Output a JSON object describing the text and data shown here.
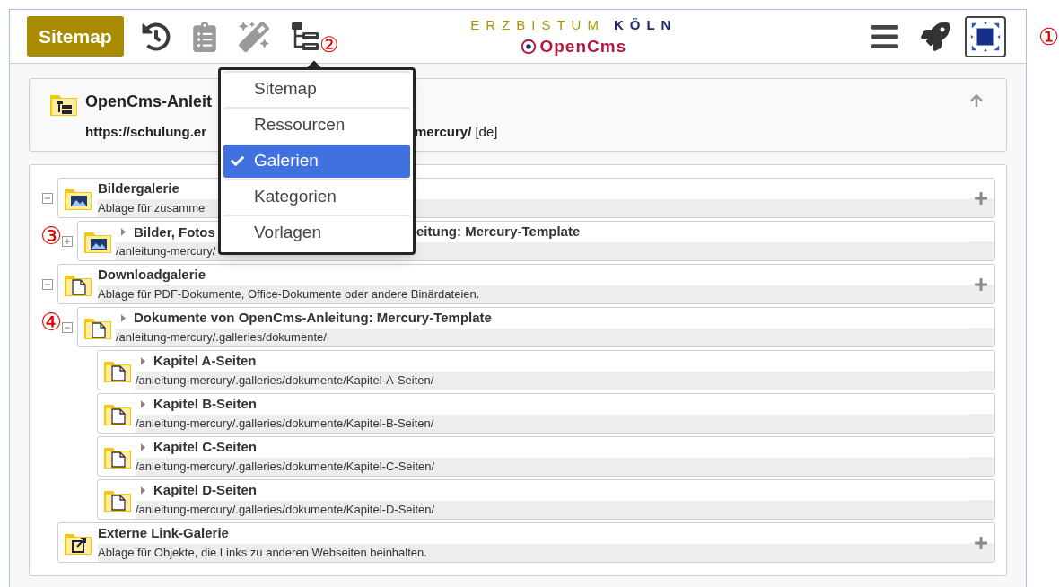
{
  "toolbar": {
    "title_button": "Sitemap",
    "tools": [
      {
        "kind": "history",
        "disabled": false
      },
      {
        "kind": "clipboard",
        "disabled": true
      },
      {
        "kind": "wand",
        "disabled": true
      },
      {
        "kind": "sitemap",
        "disabled": false,
        "marker": "②"
      }
    ],
    "logo": {
      "line_1": "ERZBISTUM",
      "line_1_accent": "KÖLN",
      "brand": "OpenCms"
    },
    "right_tools": [
      {
        "kind": "menu",
        "selected": false
      },
      {
        "kind": "rocket",
        "selected": false
      },
      {
        "kind": "select-area",
        "selected": true,
        "marker": "①"
      }
    ]
  },
  "view_menu": {
    "items": [
      {
        "label": "Sitemap",
        "selected": false
      },
      {
        "label": "Ressourcen",
        "selected": false
      },
      {
        "label": "Galerien",
        "selected": true
      },
      {
        "label": "Kategorien",
        "selected": false
      },
      {
        "label": "Vorlagen",
        "selected": false
      }
    ]
  },
  "header_card": {
    "title": "OpenCms-Anleit",
    "url_parts": [
      "https://schulung.er",
      "mercury/"
    ],
    "locale": "[de]"
  },
  "tree": [
    {
      "kind": "image-gallery",
      "title_parts": [
        "Bildergalerie"
      ],
      "subtitle_parts": [
        "Ablage für zusamme"
      ],
      "expanded": true,
      "addable": true,
      "children": [
        {
          "kind": "image-gallery",
          "title_parts": [
            "Bilder, Fotos",
            "eitung: Mercury-Template"
          ],
          "subtitle_parts": [
            "/anleitung-mercury/"
          ],
          "expanded": false,
          "addable": false,
          "marker": "③"
        }
      ]
    },
    {
      "kind": "download-gallery",
      "title_parts": [
        "Downloadgalerie"
      ],
      "subtitle_parts": [
        "Ablage für PDF-Dokumente, Office-Dokumente oder andere Binärdateien."
      ],
      "expanded": true,
      "addable": true,
      "children": [
        {
          "kind": "download-gallery",
          "title_parts": [
            "Dokumente von OpenCms-Anleitung: Mercury-Template"
          ],
          "subtitle_parts": [
            "/anleitung-mercury/.galleries/dokumente/"
          ],
          "expanded": true,
          "addable": false,
          "marker": "④",
          "children": [
            {
              "kind": "download-gallery",
              "title_parts": [
                "Kapitel A-Seiten"
              ],
              "subtitle_parts": [
                "/anleitung-mercury/.galleries/dokumente/Kapitel-A-Seiten/"
              ],
              "addable": false
            },
            {
              "kind": "download-gallery",
              "title_parts": [
                "Kapitel B-Seiten"
              ],
              "subtitle_parts": [
                "/anleitung-mercury/.galleries/dokumente/Kapitel-B-Seiten/"
              ],
              "addable": false
            },
            {
              "kind": "download-gallery",
              "title_parts": [
                "Kapitel C-Seiten"
              ],
              "subtitle_parts": [
                "/anleitung-mercury/.galleries/dokumente/Kapitel-C-Seiten/"
              ],
              "addable": false
            },
            {
              "kind": "download-gallery",
              "title_parts": [
                "Kapitel D-Seiten"
              ],
              "subtitle_parts": [
                "/anleitung-mercury/.galleries/dokumente/Kapitel-D-Seiten/"
              ],
              "addable": false
            }
          ]
        }
      ]
    },
    {
      "kind": "link-gallery",
      "title_parts": [
        "Externe Link-Galerie"
      ],
      "subtitle_parts": [
        "Ablage für Objekte, die Links zu anderen Webseiten beinhalten."
      ],
      "addable": true
    }
  ]
}
